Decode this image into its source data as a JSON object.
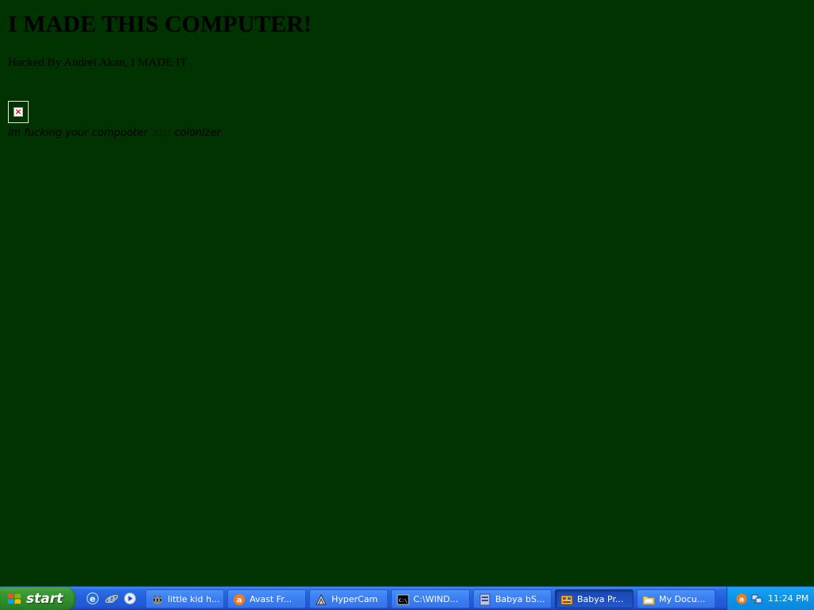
{
  "page": {
    "headline": "I MADE THIS COMPUTER!",
    "byline": "Hacked By Andrei Akan, I MADE IT",
    "tagline_start": "im fucking your compooter ",
    "tagline_mid": "2021 ",
    "tagline_end": "colonizer",
    "background_color": "#003300"
  },
  "taskbar": {
    "start_label": "start",
    "quicklaunch": [
      {
        "icon": "internet-explorer-old-icon"
      },
      {
        "icon": "internet-explorer-icon"
      },
      {
        "icon": "media-player-icon"
      }
    ],
    "buttons": [
      {
        "label": "little kid h...",
        "icon": "raccoon-app-icon",
        "active": false
      },
      {
        "label": "Avast Fr...",
        "icon": "avast-icon",
        "active": false
      },
      {
        "label": "HyperCam",
        "icon": "hypercam-icon",
        "active": false
      },
      {
        "label": "C:\\WIND...",
        "icon": "command-prompt-icon",
        "active": false
      },
      {
        "label": "Babya bS...",
        "icon": "babya-app-icon",
        "active": false
      },
      {
        "label": "Babya Pr...",
        "icon": "babya-pr-icon",
        "active": true
      },
      {
        "label": "My Docu...",
        "icon": "folder-icon",
        "active": false
      }
    ],
    "tray": {
      "icons": [
        "avast-tray-icon",
        "network-tray-icon"
      ],
      "clock": "11:24 PM"
    }
  }
}
